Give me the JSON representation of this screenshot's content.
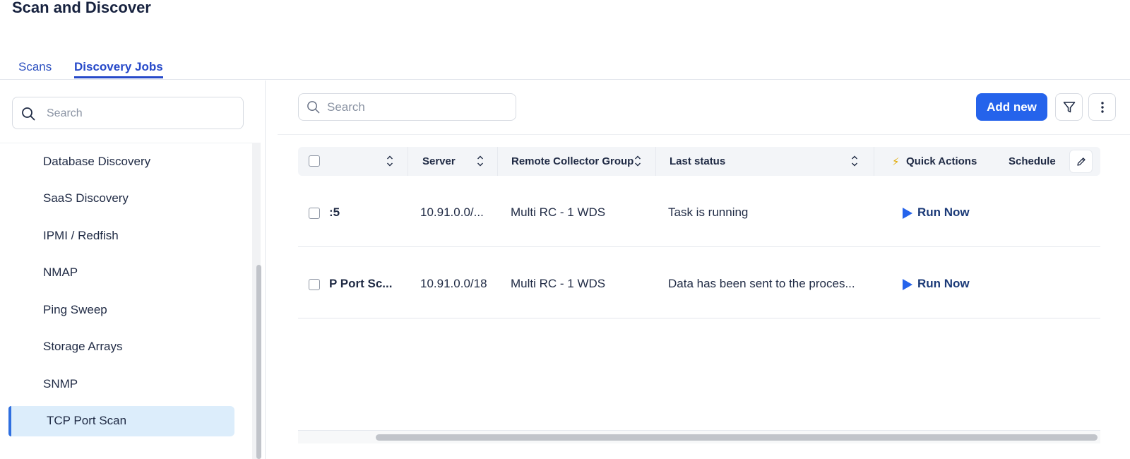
{
  "page": {
    "title": "Scan and Discover"
  },
  "tabs": [
    {
      "label": "Scans",
      "active": false
    },
    {
      "label": "Discovery Jobs",
      "active": true
    }
  ],
  "sidebar": {
    "search_placeholder": "Search",
    "items": [
      {
        "label": "Database Discovery",
        "active": false
      },
      {
        "label": "SaaS Discovery",
        "active": false
      },
      {
        "label": "IPMI / Redfish",
        "active": false
      },
      {
        "label": "NMAP",
        "active": false
      },
      {
        "label": "Ping Sweep",
        "active": false
      },
      {
        "label": "Storage Arrays",
        "active": false
      },
      {
        "label": "SNMP",
        "active": false
      },
      {
        "label": "TCP Port Scan",
        "active": true
      }
    ]
  },
  "toolbar": {
    "search_placeholder": "Search",
    "add_label": "Add new",
    "filter_icon": "filter-icon",
    "more_icon": "more-vertical-icon"
  },
  "table": {
    "columns": [
      {
        "label": ""
      },
      {
        "label": "Server"
      },
      {
        "label": "Remote Collector Group"
      },
      {
        "label": "Last status"
      },
      {
        "label": "Quick Actions",
        "icon": "⚡"
      },
      {
        "label": "Schedule"
      }
    ],
    "rows": [
      {
        "name": ":5",
        "server": "10.91.0.0/...",
        "group": "Multi RC - 1 WDS",
        "status": "Task is running",
        "action": "Run Now"
      },
      {
        "name": "P Port Sc...",
        "server": "10.91.0.0/18",
        "group": "Multi RC - 1 WDS",
        "status": "Data has been sent to the proces...",
        "action": "Run Now"
      }
    ]
  },
  "colors": {
    "accent": "#2563eb",
    "active_bg": "#dcedfb",
    "tab_active": "#2649c9"
  }
}
